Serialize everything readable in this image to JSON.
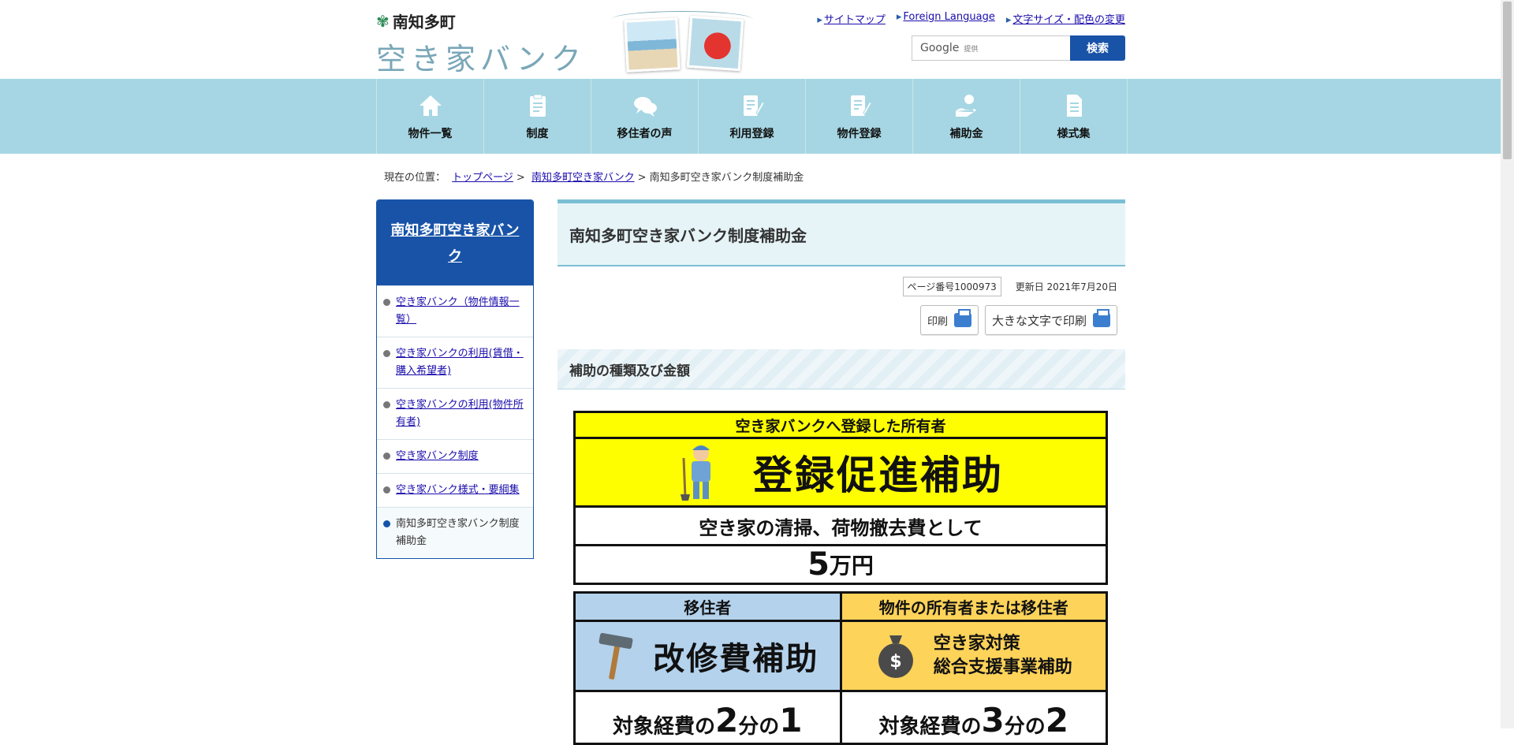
{
  "header": {
    "town_name": "南知多町",
    "site_title": "空き家バンク",
    "links": [
      "サイトマップ",
      "Foreign Language",
      "文字サイズ・配色の変更"
    ],
    "search": {
      "provider": "Google",
      "provider_sub": "提供",
      "button": "検索"
    }
  },
  "nav": {
    "items": [
      {
        "label": "物件一覧",
        "icon": "house-icon"
      },
      {
        "label": "制度",
        "icon": "clipboard-icon"
      },
      {
        "label": "移住者の声",
        "icon": "speech-bubbles-icon"
      },
      {
        "label": "利用登録",
        "icon": "document-pen-icon"
      },
      {
        "label": "物件登録",
        "icon": "document-pen-icon"
      },
      {
        "label": "補助金",
        "icon": "hand-coin-icon"
      },
      {
        "label": "様式集",
        "icon": "document-icon"
      }
    ]
  },
  "breadcrumb": {
    "prefix": "現在の位置：",
    "items": [
      "トップページ",
      "南知多町空き家バンク",
      "南知多町空き家バンク制度補助金"
    ]
  },
  "sidebar": {
    "heading": "南知多町空き家バンク",
    "items": [
      "空き家バンク（物件情報一覧）",
      "空き家バンクの利用(賃借・購入希望者)",
      "空き家バンクの利用(物件所有者)",
      "空き家バンク制度",
      "空き家バンク様式・要綱集",
      "南知多町空き家バンク制度補助金"
    ]
  },
  "main": {
    "title": "南知多町空き家バンク制度補助金",
    "page_number": "ページ番号1000973",
    "updated": "更新日 2021年7月20日",
    "print_label": "印刷",
    "print_large_label": "大きな文字で印刷",
    "section_heading": "補助の種類及び金額"
  },
  "graphic": {
    "top_caption": "空き家バンクへ登録した所有者",
    "top_title": "登録促進補助",
    "top_desc": "空き家の清掃、荷物撤去費として",
    "top_amount_num": "5",
    "top_amount_unit": "万円",
    "left_caption": "移住者",
    "left_title": "改修費補助",
    "left_ratio_prefix": "対象経費の",
    "left_ratio_a": "2",
    "left_ratio_mid": "分の",
    "left_ratio_b": "1",
    "right_caption": "物件の所有者または移住者",
    "right_title_1": "空き家対策",
    "right_title_2": "総合支援事業補助",
    "right_ratio_prefix": "対象経費の",
    "right_ratio_a": "3",
    "right_ratio_mid": "分の",
    "right_ratio_b": "2",
    "colors": {
      "yellow": "#fefe00",
      "blue": "#b4d2ec",
      "orange": "#fdd35a"
    }
  },
  "theme": {
    "nav_bg": "#a6d6e3",
    "primary": "#1853a8",
    "accent": "#7bbfd4"
  }
}
